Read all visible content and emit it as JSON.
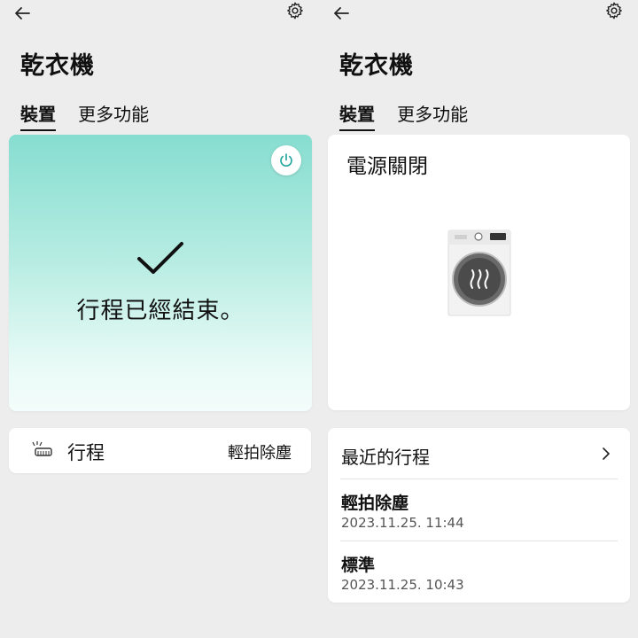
{
  "app_title": "乾衣機",
  "tabs": [
    "裝置",
    "更多功能"
  ],
  "left": {
    "status_text": "行程已經結束。",
    "course_label": "行程",
    "course_value": "輕拍除塵"
  },
  "right": {
    "power_status": "電源關閉",
    "recent_header": "最近的行程",
    "recent": [
      {
        "name": "輕拍除塵",
        "time": "2023.11.25. 11:44"
      },
      {
        "name": "標準",
        "time": "2023.11.25. 10:43"
      }
    ]
  },
  "icons": {
    "back": "arrow-left-icon",
    "settings": "gear-icon",
    "power": "power-icon",
    "check": "checkmark-icon",
    "course": "course-icon",
    "dryer": "dryer-illustration",
    "chevron": "chevron-right-icon"
  },
  "colors": {
    "status_gradient_top": "#86ddd0",
    "status_gradient_bottom": "#f3fdfb",
    "power_icon": "#1aa39a"
  }
}
